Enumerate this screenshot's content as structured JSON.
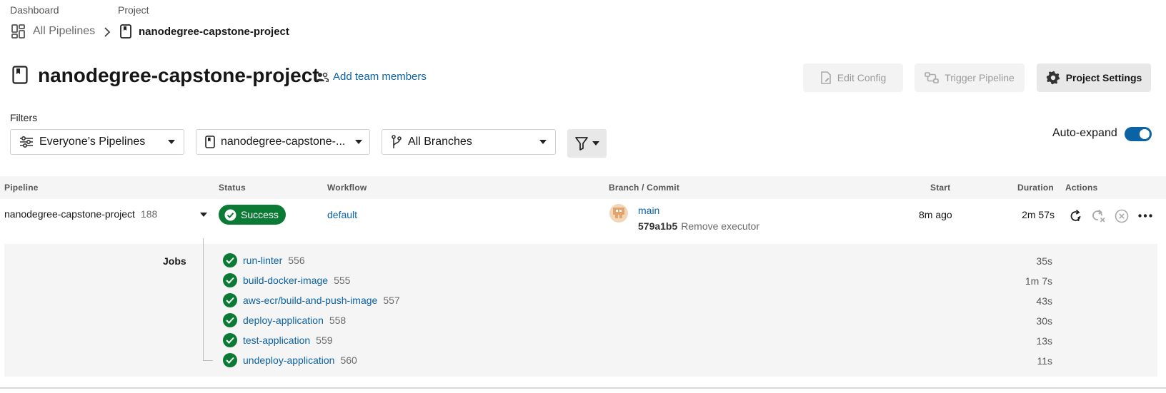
{
  "breadcrumb": {
    "dashboard_label": "Dashboard",
    "project_label": "Project",
    "all_pipelines": "All Pipelines",
    "project_name": "nanodegree-capstone-project"
  },
  "header": {
    "title": "nanodegree-capstone-project",
    "add_team_members": "Add team members",
    "edit_config": "Edit Config",
    "trigger_pipeline": "Trigger Pipeline",
    "project_settings": "Project Settings"
  },
  "filters": {
    "label": "Filters",
    "pipelines_select": "Everyone’s Pipelines",
    "project_select": "nanodegree-capstone-...",
    "branches_select": "All Branches",
    "auto_expand_label": "Auto-expand",
    "auto_expand_on": true
  },
  "table": {
    "columns": [
      "Pipeline",
      "Status",
      "Workflow",
      "Branch / Commit",
      "Start",
      "Duration",
      "Actions"
    ],
    "pipeline": {
      "name": "nanodegree-capstone-project",
      "number": "188",
      "status": "Success",
      "workflow": "default",
      "branch": "main",
      "commit_hash": "579a1b5",
      "commit_message": "Remove executor",
      "start": "8m ago",
      "duration": "2m 57s"
    },
    "jobs_label": "Jobs",
    "jobs": [
      {
        "name": "run-linter",
        "number": "556",
        "duration": "35s"
      },
      {
        "name": "build-docker-image",
        "number": "555",
        "duration": "1m 7s"
      },
      {
        "name": "aws-ecr/build-and-push-image",
        "number": "557",
        "duration": "43s"
      },
      {
        "name": "deploy-application",
        "number": "558",
        "duration": "30s"
      },
      {
        "name": "test-application",
        "number": "559",
        "duration": "13s"
      },
      {
        "name": "undeploy-application",
        "number": "560",
        "duration": "11s"
      }
    ]
  },
  "colors": {
    "success": "#0a7a34",
    "link": "#0b62a4",
    "toggle": "#0b62a4"
  }
}
